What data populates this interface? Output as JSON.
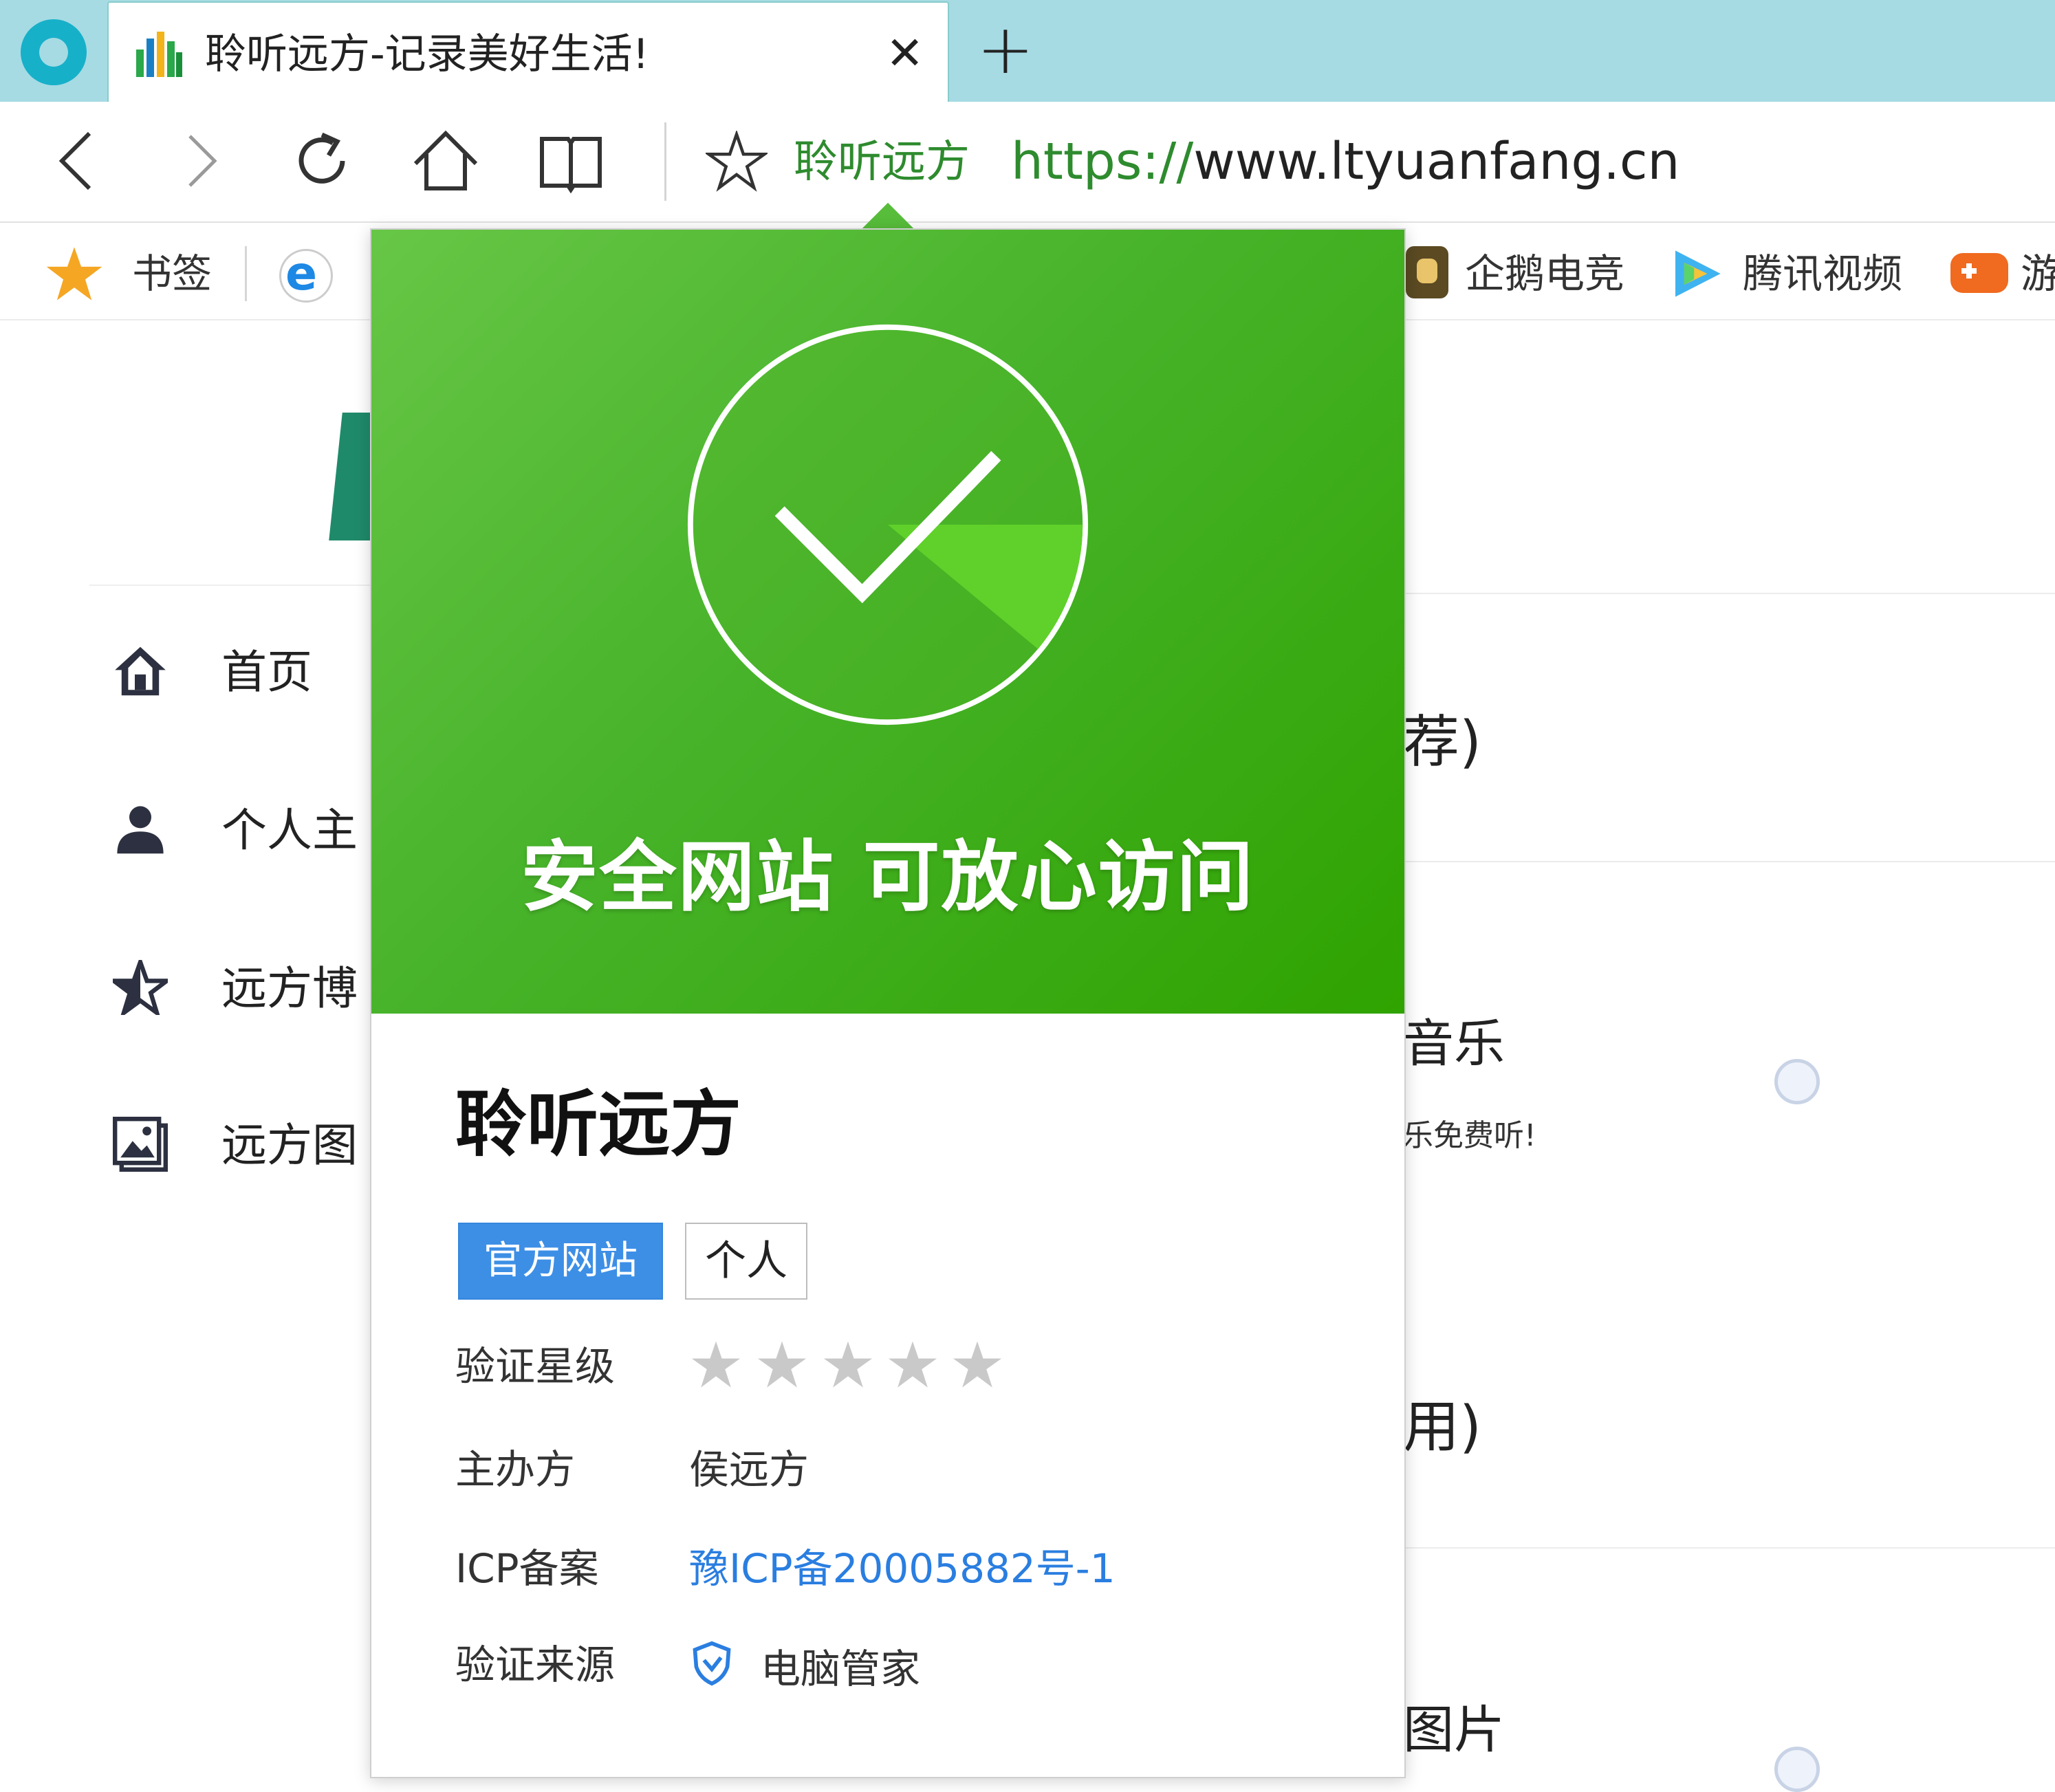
{
  "tab": {
    "title": "聆听远方-记录美好生活!",
    "close_glyph": "✕",
    "new_tab_glyph": "+"
  },
  "navbar": {
    "site_name": "聆听远方",
    "url_protocol": "https://",
    "url_host": "www.ltyuanfang.cn"
  },
  "bookmarks": {
    "items": [
      {
        "label": "书签",
        "icon": "star-icon"
      },
      {
        "label": "企鹅电竞",
        "icon": "penguin-esports-icon"
      },
      {
        "label": "腾讯视频",
        "icon": "tencent-video-icon"
      },
      {
        "label": "游",
        "icon": "game-icon"
      }
    ]
  },
  "sidebar": {
    "items": [
      {
        "label": "首页",
        "icon": "home-icon"
      },
      {
        "label": "个人主",
        "icon": "user-icon"
      },
      {
        "label": "远方博",
        "icon": "star-outline-icon"
      },
      {
        "label": "远方图",
        "icon": "gallery-icon"
      }
    ]
  },
  "background_content": {
    "heading1": "荐)",
    "heading2": "音乐",
    "subtext2": "乐免费听!",
    "heading3": "用)",
    "heading4": "图片"
  },
  "popup": {
    "hero_text": "安全网站 可放心访问",
    "site_name": "聆听远方",
    "tags": [
      "官方网站",
      "个人"
    ],
    "rating_label": "验证星级",
    "rating_stars": 0,
    "rating_max": 5,
    "organizer_label": "主办方",
    "organizer_value": "侯远方",
    "icp_label": "ICP备案",
    "icp_value": "豫ICP备20005882号-1",
    "source_label": "验证来源",
    "source_value": "电脑管家"
  },
  "colors": {
    "tabstrip": "#a6dbe4",
    "popup_green": "#47b32a",
    "link_blue": "#2a7ee0",
    "tag_blue": "#3d8fe6",
    "url_green": "#2e8b2e"
  }
}
